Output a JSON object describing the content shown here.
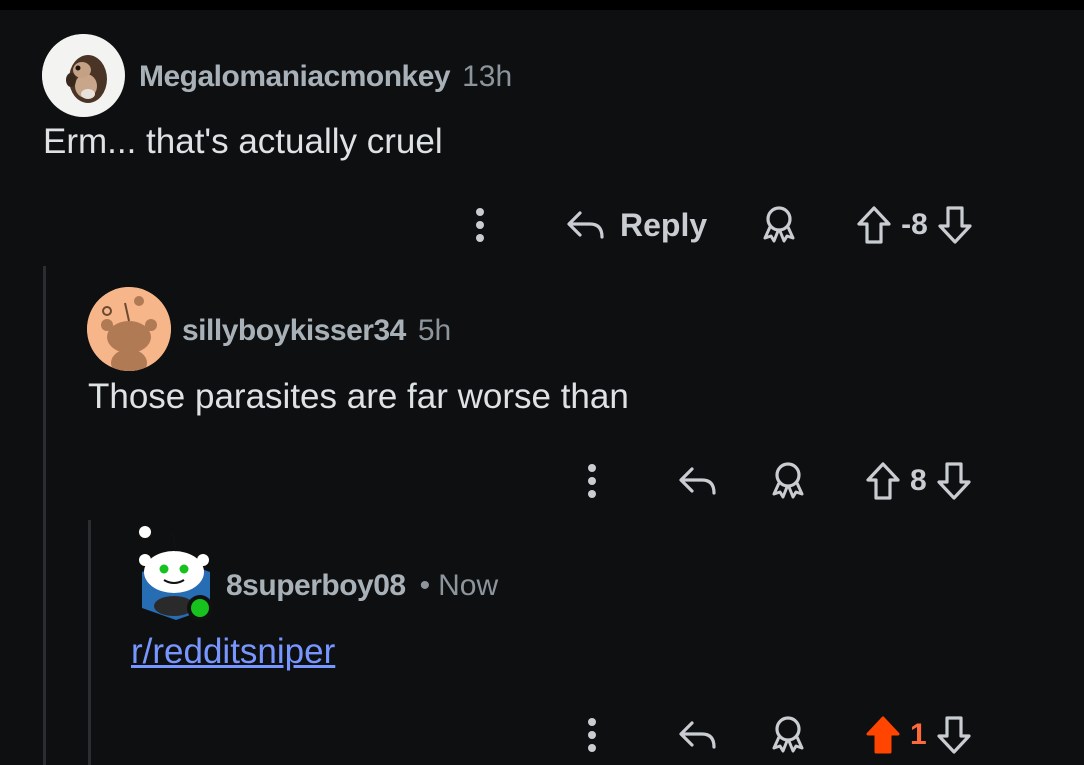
{
  "comments": [
    {
      "username": "Megalomaniacmonkey",
      "time": "13h",
      "body": "Erm... that's actually cruel",
      "avatar_icon": "monkey-avatar-icon",
      "reply_label": "Reply",
      "score": "-8",
      "vote_state": "none"
    },
    {
      "username": "sillyboykisser34",
      "time": "5h",
      "body": "Those parasites are far worse than",
      "avatar_icon": "snoo-avatar-icon",
      "score": "8",
      "vote_state": "none"
    },
    {
      "username": "8superboy08",
      "separator": "•",
      "time": "Now",
      "body": "r/redditsniper",
      "avatar_icon": "snoo-avatar-icon",
      "online": true,
      "score": "1",
      "vote_state": "upvoted"
    }
  ],
  "colors": {
    "background": "#0e0f11",
    "upvote_active": "#ff4500",
    "link": "#7796ff",
    "online": "#17c21e"
  }
}
